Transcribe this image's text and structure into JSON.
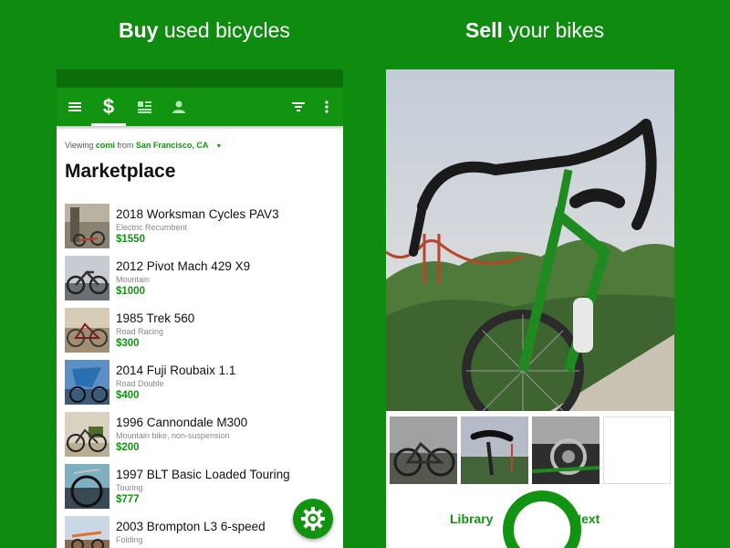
{
  "headlines": {
    "left_bold": "Buy",
    "left_rest": " used bicycles",
    "right_bold": "Sell",
    "right_rest": " your bikes"
  },
  "toolbar": {
    "icons": [
      "menu-icon",
      "dollar-icon",
      "list-icon",
      "person-icon",
      "filter-icon",
      "more-vert-icon"
    ],
    "active_tab_symbol": "$"
  },
  "viewing": {
    "prefix": "Viewing ",
    "category": "comi",
    "from": " from ",
    "location": "San Francisco, CA",
    "caret": "▼"
  },
  "page_title": "Marketplace",
  "listings": [
    {
      "title": "2018 Worksman Cycles PAV3",
      "category": "Electric Recumbent",
      "price": "$1550"
    },
    {
      "title": "2012 Pivot Mach 429 X9",
      "category": "Mountain",
      "price": "$1000"
    },
    {
      "title": "1985 Trek 560",
      "category": "Road Racing",
      "price": "$300"
    },
    {
      "title": "2014 Fuji Roubaix 1.1",
      "category": "Road Double",
      "price": "$400"
    },
    {
      "title": "1996 Cannondale M300",
      "category": "Mountain bike, non-suspension",
      "price": "$200"
    },
    {
      "title": "1997 BLT Basic Loaded Touring",
      "category": "Touring",
      "price": "$777"
    },
    {
      "title": "2003 Brompton L3 6-speed",
      "category": "Folding",
      "price": ""
    }
  ],
  "sell": {
    "library_label": "Library",
    "next_label": "Next"
  },
  "colors": {
    "brand_green": "#129412",
    "background_green": "#0f8c0f",
    "status_bar": "#0b6e0b"
  }
}
